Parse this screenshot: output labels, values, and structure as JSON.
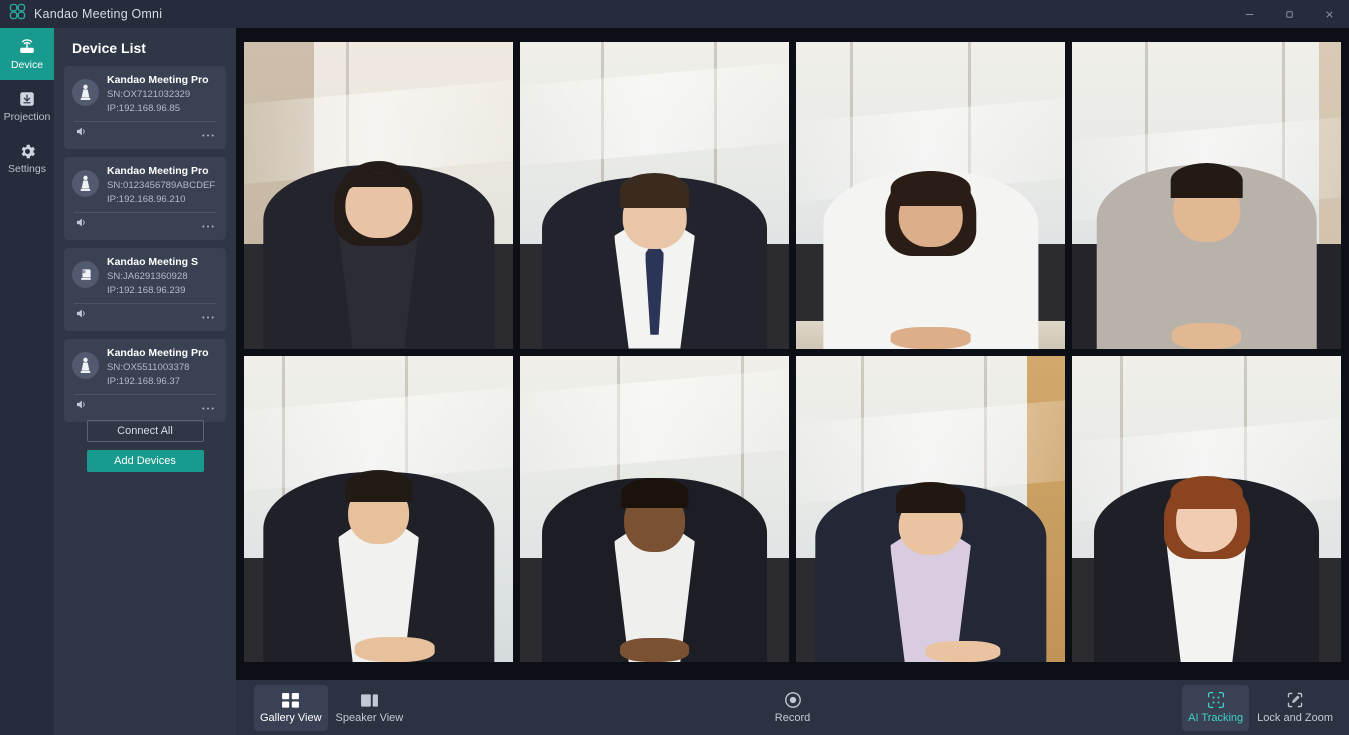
{
  "window": {
    "title": "Kandao Meeting Omni",
    "logo_icon": "kandao-logo-icon",
    "controls": {
      "minimize": "–",
      "maximize": "❐",
      "close": "✕"
    }
  },
  "rail": {
    "items": [
      {
        "label": "Device",
        "icon": "router-icon",
        "active": true
      },
      {
        "label": "Projection",
        "icon": "download-box-icon",
        "active": false
      },
      {
        "label": "Settings",
        "icon": "gear-icon",
        "active": false
      }
    ]
  },
  "panel": {
    "title": "Device List",
    "devices": [
      {
        "name": "Kandao Meeting Pro",
        "sn": "SN:OX7121032329",
        "ip": "IP:192.168.96.85",
        "avatar_icon": "device-camera-icon",
        "speaker_icon": "speaker-icon",
        "more_icon": "more-dots-icon"
      },
      {
        "name": "Kandao Meeting Pro",
        "sn": "SN:0123456789ABCDEF",
        "ip": "IP:192.168.96.210",
        "avatar_icon": "device-camera-icon",
        "speaker_icon": "speaker-icon",
        "more_icon": "more-dots-icon"
      },
      {
        "name": "Kandao Meeting S",
        "sn": "SN:JA6291360928",
        "ip": "IP:192.168.96.239",
        "avatar_icon": "device-camera-s-icon",
        "speaker_icon": "speaker-icon",
        "more_icon": "more-dots-icon"
      },
      {
        "name": "Kandao Meeting Pro",
        "sn": "SN:OX5511003378",
        "ip": "IP:192.168.96.37",
        "avatar_icon": "device-camera-icon",
        "speaker_icon": "speaker-icon",
        "more_icon": "more-dots-icon"
      }
    ],
    "connect_all_label": "Connect All",
    "add_devices_label": "Add Devices"
  },
  "stage": {
    "tiles": [
      {
        "id": "tile-1",
        "selected": false
      },
      {
        "id": "tile-2",
        "selected": false
      },
      {
        "id": "tile-3",
        "selected": false
      },
      {
        "id": "tile-4",
        "selected": true
      },
      {
        "id": "tile-5",
        "selected": false
      },
      {
        "id": "tile-6",
        "selected": false
      },
      {
        "id": "tile-7",
        "selected": false
      },
      {
        "id": "tile-8",
        "selected": false
      }
    ],
    "selected_border_color": "#3fe0e0"
  },
  "toolbar": {
    "gallery_view_label": "Gallery View",
    "speaker_view_label": "Speaker View",
    "record_label": "Record",
    "ai_tracking_label": "AI Tracking",
    "lock_and_zoom_label": "Lock and Zoom",
    "gallery_icon": "grid-icon",
    "speaker_icon": "speaker-layout-icon",
    "record_icon": "record-circle-icon",
    "ai_tracking_icon": "ai-tracking-icon",
    "lock_zoom_icon": "lock-zoom-icon",
    "accent_color": "#3fd2c7"
  }
}
